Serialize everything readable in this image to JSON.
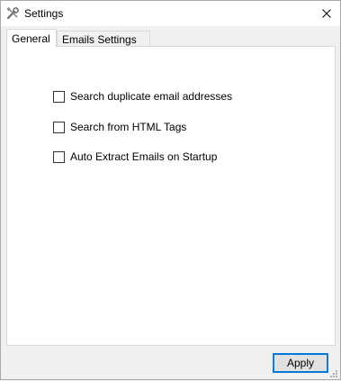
{
  "window": {
    "title": "Settings",
    "title_icon": "tools-icon",
    "close_glyph": "✕"
  },
  "tabs": [
    {
      "label": "General",
      "active": true
    },
    {
      "label": "Emails Settings",
      "active": false
    }
  ],
  "options": [
    {
      "label": "Search duplicate email addresses",
      "checked": false
    },
    {
      "label": "Search from HTML Tags",
      "checked": false
    },
    {
      "label": "Auto Extract Emails on Startup",
      "checked": false
    }
  ],
  "buttons": {
    "apply_label": "Apply"
  },
  "colors": {
    "accent": "#0078d7",
    "panel_bg": "#ffffff",
    "window_bg": "#f0f0f0"
  }
}
